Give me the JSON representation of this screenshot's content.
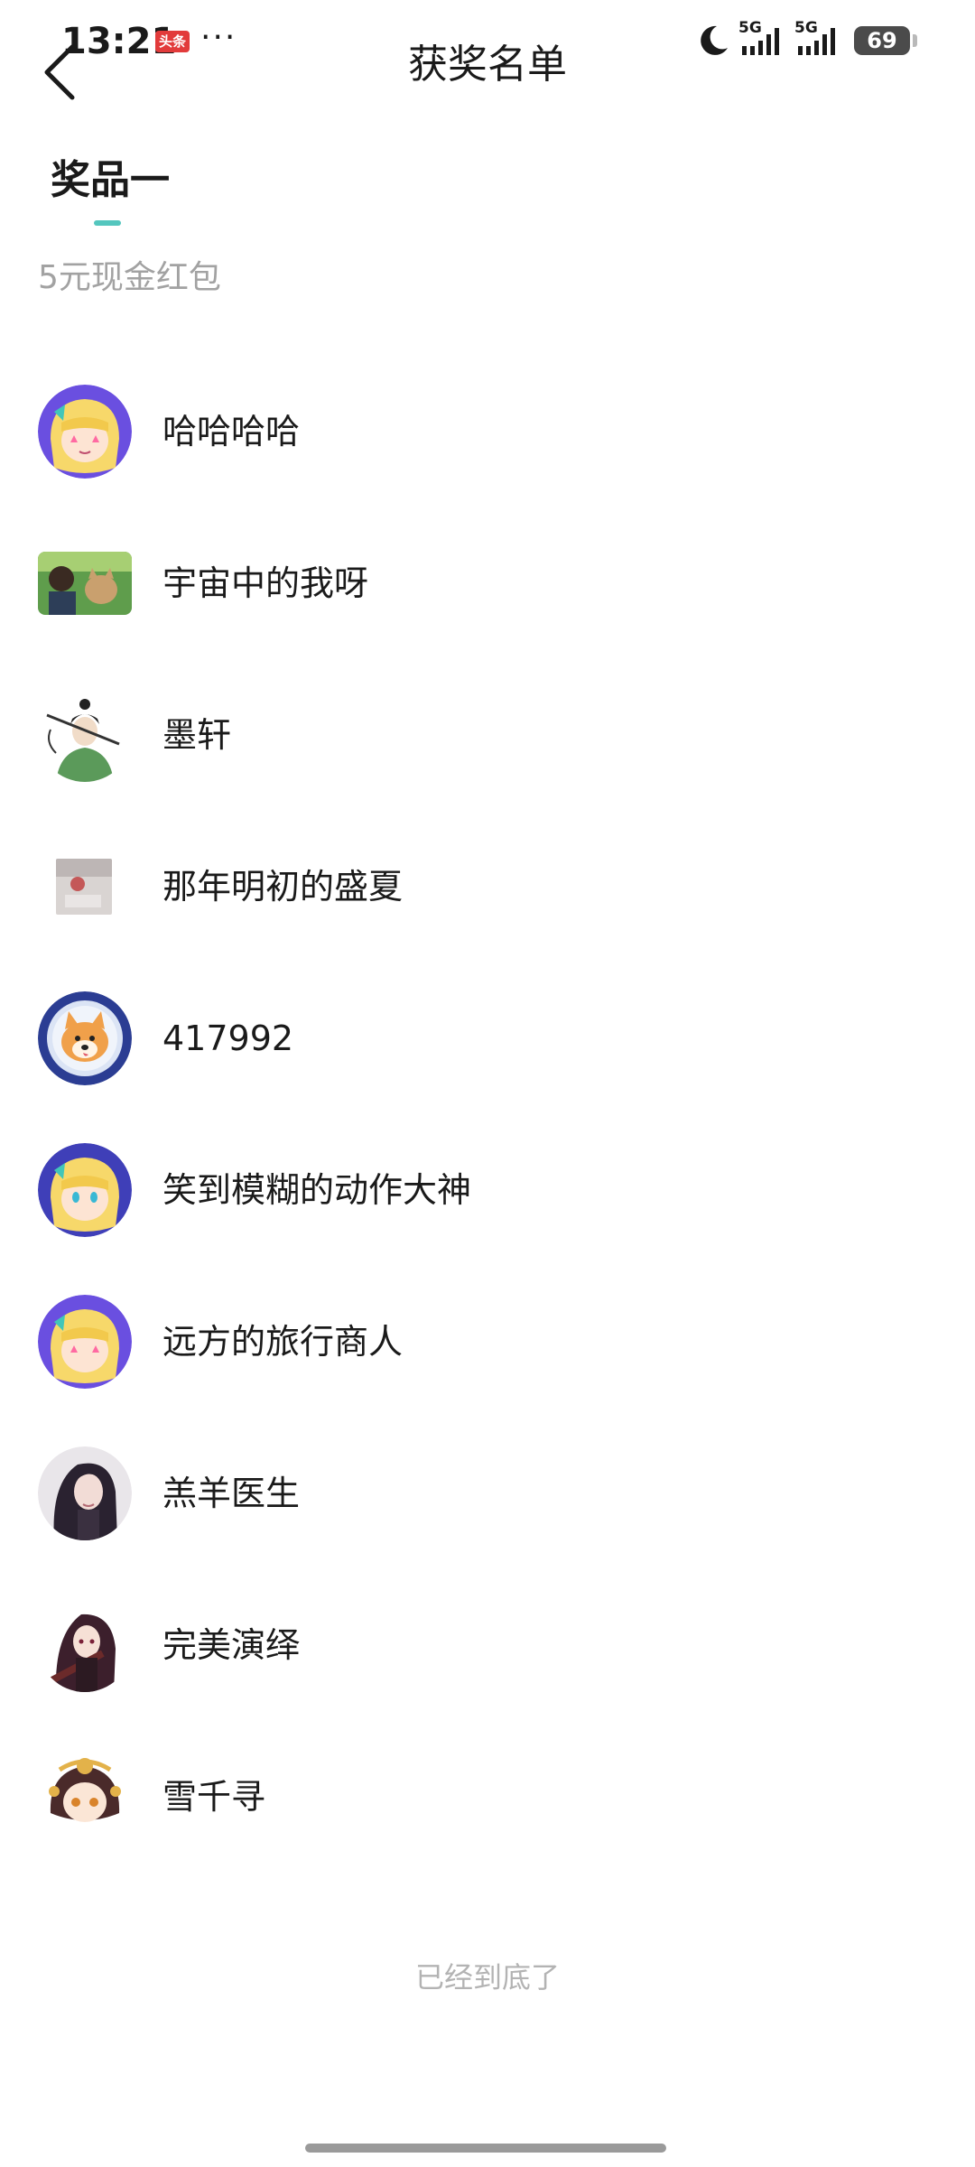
{
  "status_bar": {
    "time": "13:21",
    "badge": "头条",
    "more": "···",
    "network_1": "5G",
    "network_2": "5G",
    "battery": "69"
  },
  "header": {
    "title": "获奖名单",
    "back_icon": "chevron-left-icon"
  },
  "prize": {
    "tab_label": "奖品一",
    "description": "5元现金红包",
    "accent_color": "#54c6be"
  },
  "winners": [
    {
      "name": "哈哈哈哈",
      "avatar": "anime-girl-avatar"
    },
    {
      "name": "宇宙中的我呀",
      "avatar": "boy-with-cat-avatar"
    },
    {
      "name": "墨轩",
      "avatar": "ink-swordsman-avatar"
    },
    {
      "name": "那年明初的盛夏",
      "avatar": "photo-avatar"
    },
    {
      "name": "417992",
      "avatar": "shiba-astronaut-avatar"
    },
    {
      "name": "笑到模糊的动作大神",
      "avatar": "anime-girl-avatar"
    },
    {
      "name": "远方的旅行商人",
      "avatar": "anime-girl-avatar"
    },
    {
      "name": "羔羊医生",
      "avatar": "dark-hair-woman-avatar"
    },
    {
      "name": "完美演绎",
      "avatar": "anime-gunner-avatar"
    },
    {
      "name": "雪千寻",
      "avatar": "ornate-chibi-avatar"
    }
  ],
  "footer": {
    "end_text": "已经到底了"
  }
}
